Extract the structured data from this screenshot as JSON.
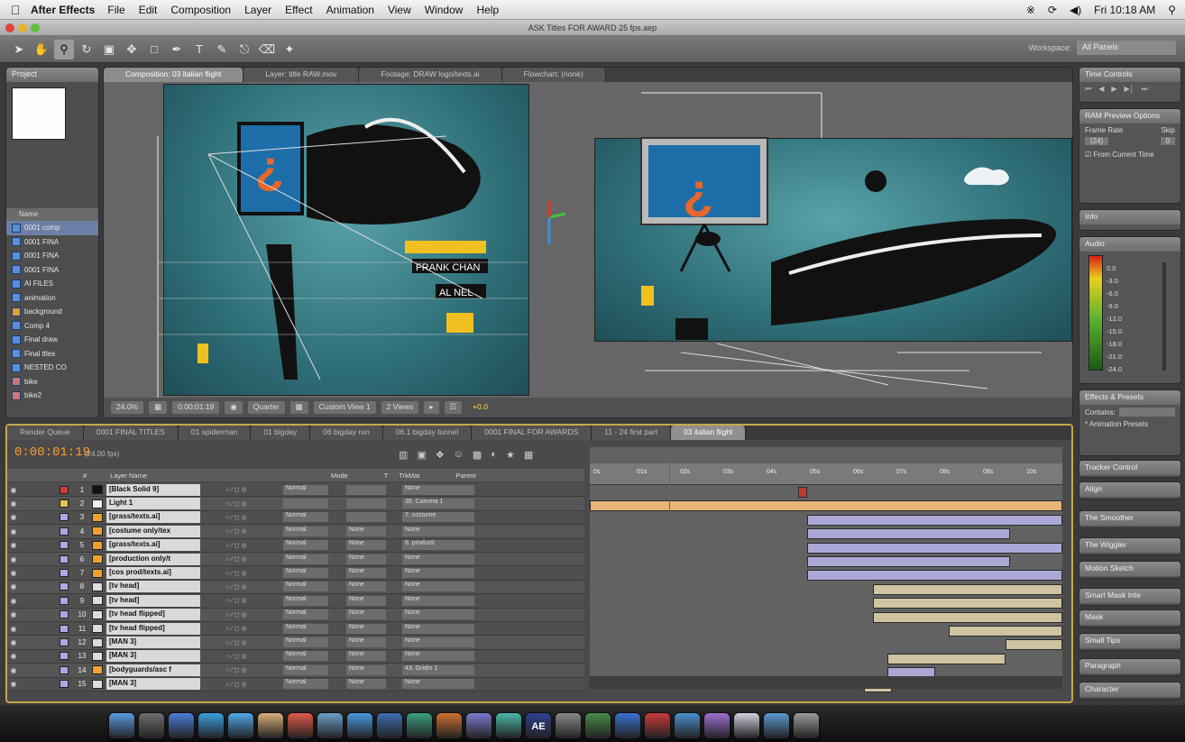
{
  "menubar": {
    "app_name": "After Effects",
    "items": [
      "File",
      "Edit",
      "Composition",
      "Layer",
      "Effect",
      "Animation",
      "View",
      "Window",
      "Help"
    ],
    "clock": "Fri 10:18 AM"
  },
  "window": {
    "title": "ASK Titles FOR AWARD 25 fps.aep"
  },
  "workspace": {
    "label": "Workspace:",
    "value": "All Panels"
  },
  "tools": [
    "selection-tool",
    "hand-tool",
    "zoom-tool",
    "rotation-tool",
    "camera-tool",
    "pan-behind-tool",
    "mask-tool",
    "pen-tool",
    "type-tool",
    "brush-tool",
    "clone-tool",
    "eraser-tool",
    "puppet-tool"
  ],
  "project": {
    "tab": "Project",
    "name_header": "Name",
    "items": [
      "0001 comp",
      "0001 FINA",
      "0001 FINA",
      "0001 FINA",
      "AI FILES",
      "animation",
      "background",
      "Comp 4",
      "Final draw",
      "Final ttles",
      "NESTED CO",
      "bike",
      "bike2"
    ]
  },
  "viewer": {
    "tabs": [
      "Composition: 03 italian flight",
      "Layer: title RAW.mov",
      "Footage: DRAW logo/texts.ai",
      "Flowchart: (none)"
    ],
    "zoom": "24.0%",
    "timecode": "0:00:01:19",
    "resolution": "Quarter",
    "view": "Custom View 1",
    "views": "2 Views",
    "exposure": "+0.0",
    "left_labels": [
      "FRANK CHAN",
      "AL NEL"
    ]
  },
  "time_controls": {
    "tab": "Time Controls"
  },
  "ram_preview": {
    "title": "RAM Preview Options",
    "frame_rate_label": "Frame Rate",
    "skip_label": "Skip",
    "frame_rate": "(24)",
    "skip": "0",
    "from_current": "From Current Time"
  },
  "info": {
    "tab": "Info"
  },
  "audio": {
    "tab": "Audio",
    "db": [
      "0.0",
      "-3.0",
      "-6.0",
      "-9.0",
      "-12.0",
      "-15.0",
      "-18.0",
      "-21.0",
      "-24.0"
    ]
  },
  "right_panels": [
    "Effects & Presets",
    "Tracker Control",
    "Align",
    "The Smoother",
    "The Wiggler",
    "Motion Sketch",
    "Smart Mask Inte",
    "Mask",
    "Small Tips",
    "Paragraph",
    "Character"
  ],
  "effects": {
    "contains_label": "Contains:",
    "animation_presets": "* Animation Presets"
  },
  "timeline": {
    "tabs": [
      "Render Queue",
      "0001 FINAL TITLES",
      "01 spiderman",
      "01 bigday",
      "06 bigday run",
      "06.1 bigday tunnel",
      "0001 FINAL FOR AWARDS",
      "11 - 24 first part",
      "03 italian flight"
    ],
    "current_time": "0:00:01:19",
    "fps": "(24.00 fps)",
    "columns": [
      "#",
      "Layer Name",
      "Mode",
      "T",
      "TrkMat",
      "Parent"
    ],
    "layers": [
      {
        "num": "1",
        "name": "[Black Solid 9]",
        "mode": "Normal",
        "trk": "",
        "parent": "None",
        "label": "#d03a3a",
        "icon": "#111"
      },
      {
        "num": "2",
        "name": "Light 1",
        "mode": "",
        "trk": "",
        "parent": "35. Camera 1",
        "label": "#e3c54a",
        "icon": "#eee"
      },
      {
        "num": "3",
        "name": "[grass/texts.ai]",
        "mode": "Normal",
        "trk": "",
        "parent": "7. costume",
        "label": "#a9a9e6",
        "icon": "#f0a030"
      },
      {
        "num": "4",
        "name": "[costume only/tex",
        "mode": "Normal",
        "trk": "None",
        "parent": "None",
        "label": "#a9a9e6",
        "icon": "#f0a030"
      },
      {
        "num": "5",
        "name": "[grass/texts.ai]",
        "mode": "Normal",
        "trk": "None",
        "parent": "6. producti",
        "label": "#a9a9e6",
        "icon": "#f0a030"
      },
      {
        "num": "6",
        "name": "[production only/t",
        "mode": "Normal",
        "trk": "None",
        "parent": "None",
        "label": "#a9a9e6",
        "icon": "#f0a030"
      },
      {
        "num": "7",
        "name": "[cos prod/texts.ai]",
        "mode": "Normal",
        "trk": "None",
        "parent": "None",
        "label": "#a9a9e6",
        "icon": "#f0a030"
      },
      {
        "num": "8",
        "name": "[tv head]",
        "mode": "Normal",
        "trk": "None",
        "parent": "None",
        "label": "#a9a9e6",
        "icon": "#ddd"
      },
      {
        "num": "9",
        "name": "[tv head]",
        "mode": "Normal",
        "trk": "None",
        "parent": "None",
        "label": "#a9a9e6",
        "icon": "#ddd"
      },
      {
        "num": "10",
        "name": "[tv head flipped]",
        "mode": "Normal",
        "trk": "None",
        "parent": "None",
        "label": "#a9a9e6",
        "icon": "#ddd"
      },
      {
        "num": "11",
        "name": "[tv head flipped]",
        "mode": "Normal",
        "trk": "None",
        "parent": "None",
        "label": "#a9a9e6",
        "icon": "#ddd"
      },
      {
        "num": "12",
        "name": "[MAN 3]",
        "mode": "Normal",
        "trk": "None",
        "parent": "None",
        "label": "#a9a9e6",
        "icon": "#ddd"
      },
      {
        "num": "13",
        "name": "[MAN 3]",
        "mode": "Normal",
        "trk": "None",
        "parent": "None",
        "label": "#a9a9e6",
        "icon": "#ddd"
      },
      {
        "num": "14",
        "name": "[bodyguards/asc f",
        "mode": "Normal",
        "trk": "None",
        "parent": "43. Gridin 1",
        "label": "#a9a9e6",
        "icon": "#f0a030"
      },
      {
        "num": "15",
        "name": "[MAN 3]",
        "mode": "Normal",
        "trk": "None",
        "parent": "None",
        "label": "#a9a9e6",
        "icon": "#ddd"
      }
    ],
    "ruler_ticks": [
      "0s",
      "01s",
      "02s",
      "03s",
      "04s",
      "05s",
      "06s",
      "07s",
      "08s",
      "09s",
      "10s"
    ]
  },
  "dock": {
    "apps": [
      "Finder",
      "Dashboard",
      "Mail",
      "Safari",
      "iChat",
      "Address Book",
      "iCal",
      "Preview",
      "iTunes",
      "Spaces",
      "Time Machine",
      "Photo Booth",
      "Script Editor",
      "Grapher",
      "After Effects",
      "System Preferences",
      "Utilities",
      "Bridge",
      "Adobe",
      "Applications",
      "Documents",
      "Finder Folder",
      "Downloads",
      "Trash"
    ],
    "ae_label": "AE"
  }
}
